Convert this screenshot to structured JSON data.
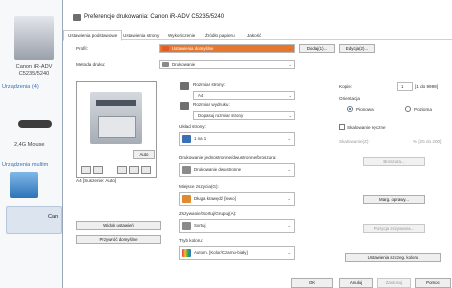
{
  "window": {
    "title": "Preferencje drukowania: Canon iR-ADV C5235/5240"
  },
  "background": {
    "device_name": "Canon iR-ADV\nC5235/5240",
    "section_devices": "Urządzenia (4)",
    "mouse_name": "2,4G Mouse",
    "section_multimedia": "Urządzenia multim",
    "partial_label": "Can"
  },
  "tabs": [
    {
      "label": "Ustawienia podstawowe"
    },
    {
      "label": "Ustawienia strony"
    },
    {
      "label": "Wykończenie"
    },
    {
      "label": "Źródło papieru"
    },
    {
      "label": "Jakość"
    }
  ],
  "profile": {
    "label": "Profil:",
    "value": "Ustawienia domyślne",
    "add_button": "Dodaj(1)...",
    "edit_button": "Edycja(2)..."
  },
  "output_method": {
    "label": "Metoda druku:",
    "value": "Drukowanie"
  },
  "preview": {
    "caption": "A4 [Suszenie: Auto]",
    "auto_button": "Auto"
  },
  "left_buttons": {
    "view_settings": "Widok ustawień",
    "restore_defaults": "Przywróć domyślne"
  },
  "page_size": {
    "label": "Rozmiar strony:",
    "value": "A4"
  },
  "output_size": {
    "label": "Rozmiar wydruku:",
    "value": "Dopasuj rozmiar strony"
  },
  "copies": {
    "label": "Kopie:",
    "value": "1",
    "range": "[1 do 9999]"
  },
  "orientation": {
    "label": "Orientacja",
    "portrait": "Pionowa",
    "landscape": "Pozioma"
  },
  "page_layout": {
    "label": "Układ strony:",
    "value": "1 na 1"
  },
  "manual_scaling": {
    "label": "Skalowanie ręczne",
    "field_label": "Skalowanie(Z):",
    "range": "% [25 do 200]"
  },
  "print_style": {
    "label": "Drukowanie jednostronne/dwustronne/broszura:",
    "value": "Drukowanie dwustronne",
    "booklet_button": "Broszura..."
  },
  "binding": {
    "label": "Miejsce zszycia(G):",
    "value": "Długa krawędź [lewo]",
    "margin_button": "Marg. oprawy..."
  },
  "finishing": {
    "label": "Zszywanie/Sortuj/Grupuj(A):",
    "value": "Sortuj",
    "staple_button": "Pozycja zszywania..."
  },
  "color_mode": {
    "label": "Tryb koloru:",
    "value": "Autom. [Kolor/Czarno-biały]",
    "color_settings_button": "Ustawienia szczeg. koloru"
  },
  "footer": {
    "ok": "OK",
    "cancel": "Anuluj",
    "apply": "Zastosuj",
    "help": "Pomoc"
  }
}
